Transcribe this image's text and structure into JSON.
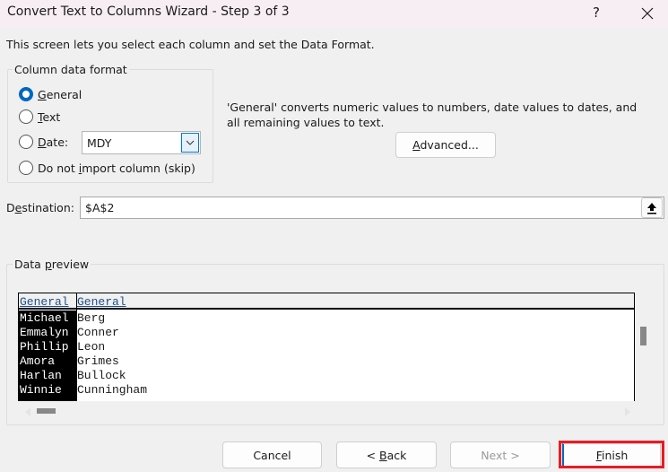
{
  "window": {
    "title": "Convert Text to Columns Wizard - Step 3 of 3",
    "help_label": "?",
    "close_icon": "close-icon"
  },
  "intro_text": "This screen lets you select each column and set the Data Format.",
  "column_format": {
    "legend": "Column data format",
    "options": [
      {
        "label_mnemonic": "G",
        "label_rest": "eneral",
        "checked": true
      },
      {
        "label_mnemonic": "T",
        "label_rest": "ext",
        "checked": false
      },
      {
        "label_mnemonic": "D",
        "label_rest": "ate:",
        "checked": false
      },
      {
        "label_prefix": "Do not ",
        "label_mnemonic": "i",
        "label_rest": "mport column (skip)",
        "checked": false
      }
    ],
    "date_format": {
      "selected": "MDY",
      "arrow_icon": "chevron-down-icon"
    }
  },
  "description": "'General' converts numeric values to numbers, date values to dates, and all remaining values to text.",
  "advanced_button": {
    "mnemonic": "A",
    "rest": "dvanced..."
  },
  "destination": {
    "label_prefix": "D",
    "label_mnemonic": "e",
    "label_rest": "stination:",
    "value": "$A$2",
    "collapse_icon": "collapse-dialog-icon"
  },
  "data_preview": {
    "legend_prefix": "Data ",
    "legend_mnemonic": "p",
    "legend_rest": "review",
    "headers": [
      "General",
      "General"
    ],
    "rows": [
      [
        "Michael",
        "Berg"
      ],
      [
        "Emmalyn",
        "Conner"
      ],
      [
        "Phillip",
        "Leon"
      ],
      [
        "Amora",
        "Grimes"
      ],
      [
        "Harlan",
        "Bullock"
      ],
      [
        "Winnie",
        "Cunningham"
      ]
    ],
    "selected_column": 0
  },
  "buttons": {
    "cancel": "Cancel",
    "back_prefix": "< ",
    "back_mnemonic": "B",
    "back_rest": "ack",
    "next": "Next >",
    "finish_mnemonic": "F",
    "finish_rest": "inish"
  },
  "colors": {
    "accent": "#0067c0",
    "highlight": "#e81c24",
    "title_bar": "#f7eef4"
  }
}
